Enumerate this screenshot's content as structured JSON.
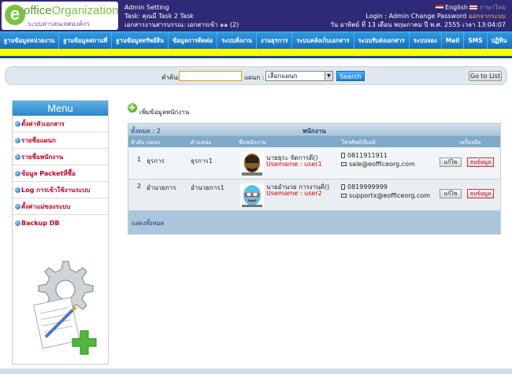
{
  "header": {
    "logo_e": "e",
    "logo_main": "office",
    "logo_main2": "Organization",
    "logo_sub": "ระบบสารสนเทศองค์กร",
    "line1": "Admin Setting",
    "line2": "Task: คุณมี Task 2 Task",
    "line3_label": "เอกสารงานสารบรรณ: ",
    "line3_value": "เอกสารเข้า ๑๑ (2)",
    "lang_en": "English",
    "lang_th": "ภาษาไทย",
    "login_text": "Login : Admin Change Password ",
    "logout": "ออกจากระบบ",
    "date": "วัน อาทิตย์ ที่ 13 เดือน พฤษภาคม ปี พ.ศ. 2555 เวลา 13:04:07"
  },
  "nav": [
    "ฐานข้อมูลหน่วยงาน",
    "ฐานข้อมูลสถานที่",
    "ฐานข้อมูลทรัพย์สิน",
    "ข้อมูลการติดต่อ",
    "ระบบสั่งงาน",
    "งานธุรการ",
    "ระบบคลังเก็บเอกสาร",
    "ระบบรับส่งเอกสาร",
    "ระบบจอง",
    "Mail",
    "SMS",
    "ปฏิทิน"
  ],
  "search": {
    "keyword_label": "คำค้น:",
    "keyword_value": "",
    "dept_label": "แผนก :",
    "dept_value": "เลือกแผนก",
    "search_button": "Search",
    "goto_button": "Go to List"
  },
  "sidebar": {
    "title": "Menu",
    "items": [
      "ตั้งค่าหัวเอกสาร",
      "รายชื่อแผนก",
      "รายชื่อพนักงาน",
      "ข้อมูล Packetที่ซื้อ",
      "Log การเข้าใช้งานระบบ",
      "ตั้งค่าแม่ของระบบ",
      "Backup DB"
    ]
  },
  "main": {
    "add_label": "เพิ่มข้อมูลพนักงาน",
    "count_label": "ทั้งหมด : 2",
    "panel_title": "พนักงาน",
    "columns": [
      "ลำดับ",
      "แผนก",
      "ตำแหน่ง",
      "ชื่อพนักงาน",
      "โทรศัพท์/อีเมล์",
      "เครื่องมือ"
    ],
    "rows": [
      {
        "no": "1",
        "dept": "ธุรการ",
        "position": "ธุรการ1",
        "name": "นายธุระ จัดการดี()",
        "username": "Usemame : user1",
        "phone": "0811911911",
        "email": "sale@eofficeorg.com",
        "edit": "แก้ไข",
        "delete": "ลบข้อมูล"
      },
      {
        "no": "2",
        "dept": "อำนวยการ",
        "position": "อำนวยการ1",
        "name": "นายอำนวย การงานดี()",
        "username": "Usemame : user2",
        "phone": "0819999999",
        "email": "supportx@eofficeorg.com",
        "edit": "แก้ไข",
        "delete": "ลบข้อมูล"
      }
    ],
    "show_all": "แสดงทั้งหมด"
  }
}
